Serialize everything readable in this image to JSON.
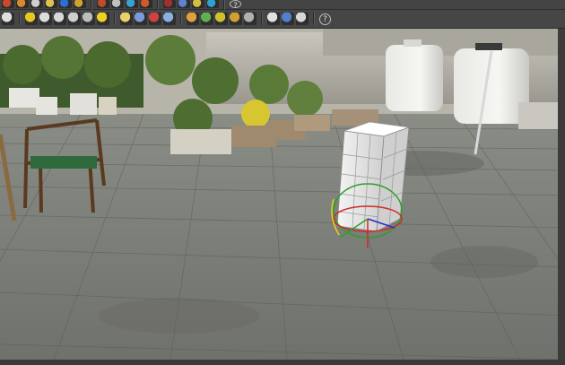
{
  "toolbar_top": {
    "icons": [
      {
        "name": "link-icon",
        "color": "#c94a2a"
      },
      {
        "name": "unlink-icon",
        "color": "#d88a2a"
      },
      {
        "name": "bind-space-warp-icon",
        "color": "#cfcfcf"
      },
      {
        "name": "select-filter-icon",
        "color": "#e0c050"
      },
      {
        "name": "select-object-icon",
        "color": "#2a6fd4"
      },
      {
        "name": "select-by-name-icon",
        "color": "#d0a030"
      },
      {
        "name": "rectangular-selection-icon",
        "color": "#c04a2a"
      },
      {
        "name": "move-icon",
        "color": "#c0c0c0"
      },
      {
        "name": "rotate-icon",
        "color": "#3aa0d0"
      },
      {
        "name": "scale-icon",
        "color": "#d05a2a"
      },
      {
        "name": "snap-icon",
        "color": "#a03030"
      },
      {
        "name": "mirror-icon",
        "color": "#6080d0"
      },
      {
        "name": "align-icon",
        "color": "#d0c040"
      },
      {
        "name": "layer-icon",
        "color": "#30a0d0"
      },
      {
        "name": "help-icon",
        "color": "#cfcfcf"
      }
    ]
  },
  "toolbar_main": {
    "icons": [
      {
        "name": "create-panel-icon",
        "color": "#e0e0e0"
      },
      {
        "name": "box-icon",
        "color": "#e6c81e"
      },
      {
        "name": "sphere-icon",
        "color": "#dcdcdc"
      },
      {
        "name": "cylinder-icon",
        "color": "#d8d8d8"
      },
      {
        "name": "torus-icon",
        "color": "#cfcfcf"
      },
      {
        "name": "cone-icon",
        "color": "#bdbdbd"
      },
      {
        "name": "light-icon",
        "color": "#f0d020"
      },
      {
        "name": "camera-icon",
        "color": "#e8d06a"
      },
      {
        "name": "helper-icon",
        "color": "#7b9ad8"
      },
      {
        "name": "space-warp-icon",
        "color": "#d04040"
      },
      {
        "name": "systems-icon",
        "color": "#8ab0e0"
      },
      {
        "name": "material-editor-icon",
        "color": "#e0a040"
      },
      {
        "name": "render-setup-icon",
        "color": "#60b050"
      },
      {
        "name": "rendered-frame-icon",
        "color": "#d0c030"
      },
      {
        "name": "render-icon",
        "color": "#d0a030"
      },
      {
        "name": "environment-icon",
        "color": "#b0b0b0"
      },
      {
        "name": "curve-editor-icon",
        "color": "#e0e0e0"
      },
      {
        "name": "schematic-view-icon",
        "color": "#5080d0"
      },
      {
        "name": "layers-icon",
        "color": "#d8d8d8"
      },
      {
        "name": "help-icon",
        "color": "#cfcfcf"
      }
    ]
  },
  "viewport": {
    "name": "perspective-viewport"
  }
}
